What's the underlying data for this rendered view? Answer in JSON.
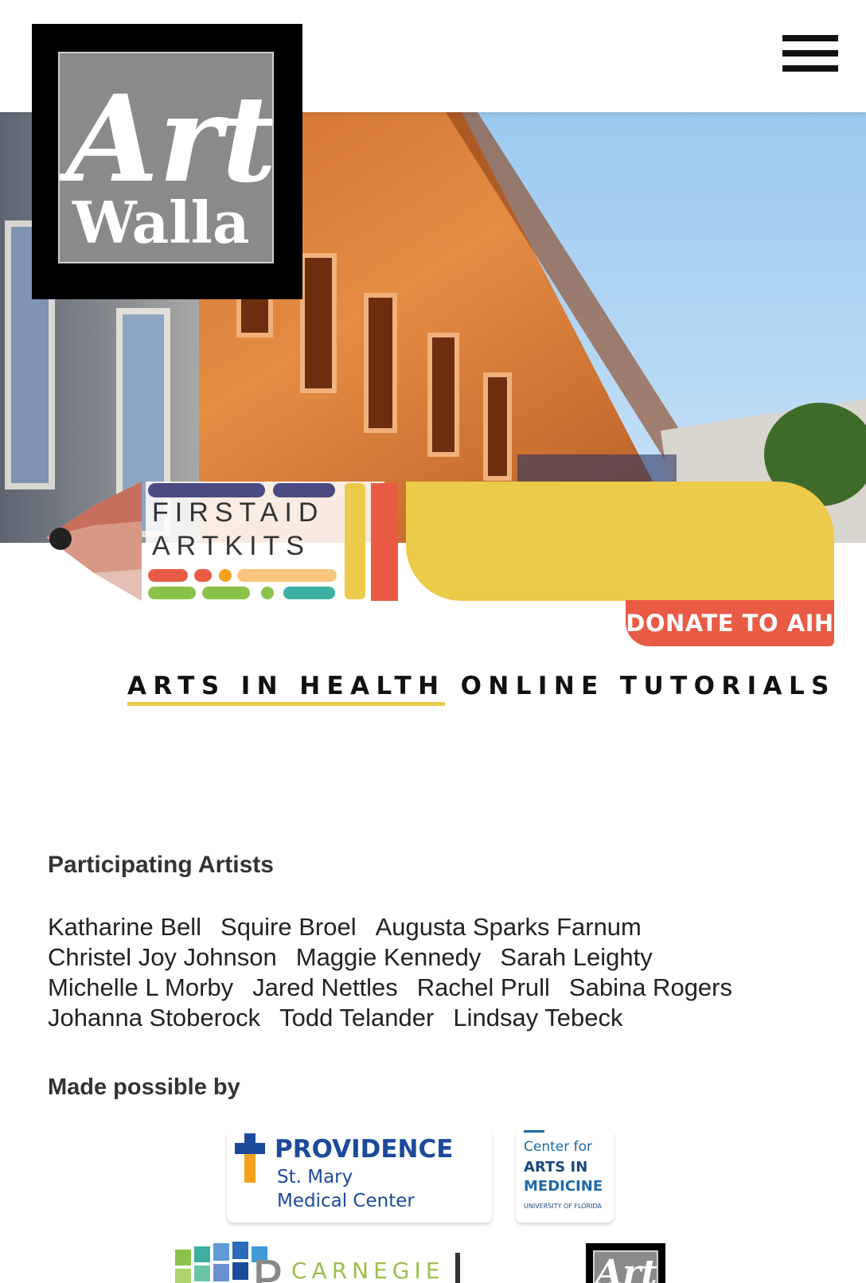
{
  "brand": {
    "logo_line1": "Art",
    "logo_line2": "Walla"
  },
  "header": {
    "menu_icon": "hamburger-menu-icon"
  },
  "banner": {
    "kit_line1": "FIRSTAID",
    "kit_line2": "ARTKITS",
    "donate_label": "DONATE TO AIH"
  },
  "page": {
    "title_underlined": "ARTS IN HEALTH",
    "title_rest": " ONLINE TUTORIALS"
  },
  "artists": {
    "heading": "Participating Artists",
    "rows": [
      [
        "Katharine Bell",
        "Squire Broel",
        "Augusta Sparks Farnum"
      ],
      [
        "Christel Joy Johnson",
        "Maggie Kennedy",
        "Sarah Leighty"
      ],
      [
        "Michelle L Morby",
        "Jared Nettles",
        "Rachel Prull",
        "Sabina Rogers"
      ],
      [
        "Johanna Stoberock",
        "Todd Telander",
        "Lindsay Tebeck"
      ]
    ]
  },
  "sponsors": {
    "heading": "Made possible by",
    "providence": {
      "name": "PROVIDENCE",
      "line2": "St. Mary",
      "line3": "Medical Center"
    },
    "cam": {
      "line1": "Center for",
      "line2": "ARTS IN",
      "line3": "MEDICINE",
      "line4": "UNIVERSITY OF FLORIDA"
    },
    "carnegie": {
      "letter": "P",
      "text": "CARNEGIE"
    },
    "artwalla_small": "Art"
  },
  "colors": {
    "accent_yellow": "#ecca4a",
    "donate_red": "#e95b45",
    "providence_blue": "#1b4a9b",
    "providence_orange": "#f5a21b"
  }
}
